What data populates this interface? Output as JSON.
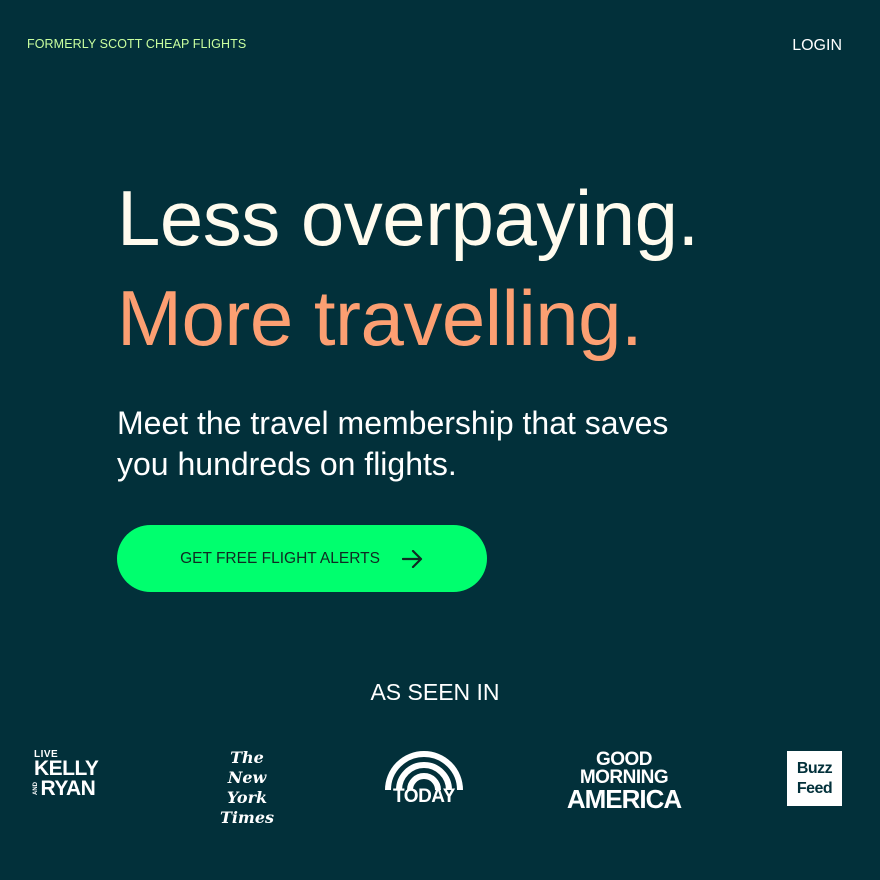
{
  "header": {
    "formerly": "FORMERLY SCOTT CHEAP FLIGHTS",
    "login": "LOGIN"
  },
  "hero": {
    "line1": "Less overpaying.",
    "line2": "More travelling.",
    "sub": "Meet the travel membership that saves you hundreds on flights.",
    "cta_label": "GET FREE FLIGHT ALERTS"
  },
  "as_seen_in": {
    "heading": "AS SEEN IN",
    "logos": {
      "kelly": {
        "live": "LIVE",
        "kelly": "KELLY",
        "and": "AND",
        "ryan": "RYAN"
      },
      "nyt": {
        "line1": "The",
        "line2": "New York",
        "line3": "Times"
      },
      "today": "TODAY",
      "gma": {
        "line1": "GOOD",
        "line2": "MORNING",
        "line3": "AMERICA"
      },
      "buzzfeed": {
        "line1": "Buzz",
        "line2": "Feed"
      }
    }
  },
  "colors": {
    "background": "#02303a",
    "accent_orange": "#fc9f72",
    "cta_green": "#00ff6e",
    "eyebrow_green": "#c9ff9f"
  },
  "icons": {
    "cta_icon": "arrow-right-icon",
    "today_icon": "rainbow-icon"
  }
}
